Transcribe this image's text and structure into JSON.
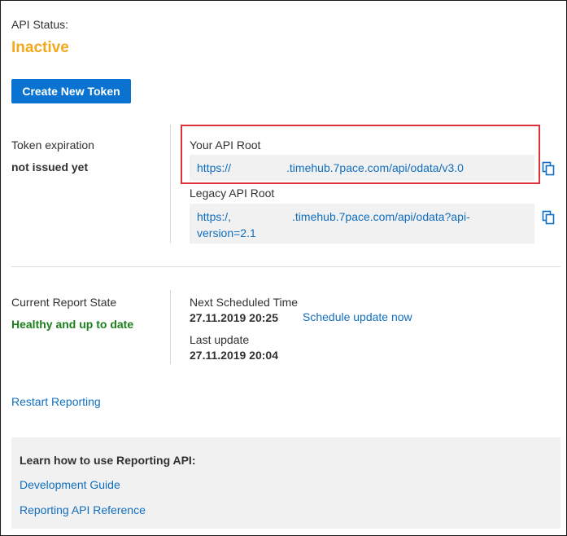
{
  "api_status": {
    "label": "API Status:",
    "value": "Inactive",
    "value_color": "#f4a81d"
  },
  "create_token_button": {
    "label": "Create New Token",
    "color": "#0a73d1"
  },
  "token": {
    "label": "Token expiration",
    "value": "not issued yet"
  },
  "api_root": {
    "label": "Your API Root",
    "url_prefix": "https://",
    "url_suffix": ".timehub.7pace.com/api/odata/v3.0",
    "highlight_color": "#e0313b"
  },
  "legacy_api_root": {
    "label": "Legacy API Root",
    "url_prefix": "https:/,",
    "url_suffix": ".timehub.7pace.com/api/odata?api-",
    "url_line2": "version=2.1"
  },
  "report_state": {
    "label": "Current Report State",
    "value": "Healthy and up to date",
    "value_color": "#1a7f1a"
  },
  "schedule": {
    "next_label": "Next Scheduled Time",
    "next_value": "27.11.2019 20:25",
    "update_now_link": "Schedule update now",
    "last_label": "Last update",
    "last_value": "27.11.2019 20:04"
  },
  "restart_link": "Restart Reporting",
  "guide": {
    "title": "Learn how to use Reporting API:",
    "links": [
      "Development Guide",
      "Reporting API Reference"
    ]
  },
  "icons": {
    "copy_api_root": "copy-icon",
    "copy_legacy_root": "copy-icon"
  }
}
